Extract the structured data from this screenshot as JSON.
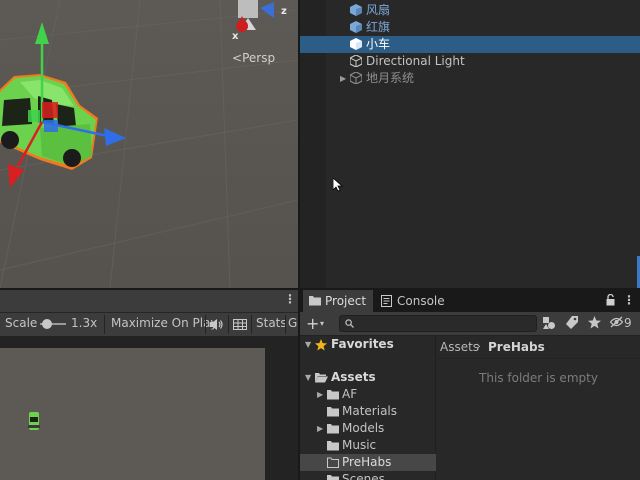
{
  "scene": {
    "persp_label": "Persp",
    "gizmo_axes": {
      "x": "x",
      "z": "z"
    },
    "colors": {
      "car_body": "#6cd24e",
      "car_outline": "#f07a1e",
      "axis_y": "#3fd24a",
      "axis_x": "#d91f1f",
      "axis_z": "#2f6ee6"
    }
  },
  "hierarchy": {
    "items": [
      {
        "label": "风扇",
        "style": "blue",
        "icon": "prefab-cube-icon"
      },
      {
        "label": "红旗",
        "style": "blue",
        "icon": "prefab-cube-icon"
      },
      {
        "label": "小车",
        "style": "selected",
        "icon": "prefab-cube-icon"
      },
      {
        "label": "Directional Light",
        "style": "normal",
        "icon": "gameobject-cube-icon"
      },
      {
        "label": "地月系统",
        "style": "gray",
        "icon": "gameobject-cube-icon",
        "foldout": "▶"
      }
    ],
    "selection_color": "#2c5d87"
  },
  "game": {
    "menu_glyph": "⋮",
    "scale_label": "Scale",
    "scale_value": "1.3x",
    "maximize_label": "Maximize On Play",
    "stats_label": "Stats",
    "gizmos_label": "G"
  },
  "project": {
    "tabs": {
      "project": "Project",
      "console": "Console"
    },
    "menu_glyph": "⋮",
    "add_label": "+",
    "add_caret": "▾",
    "search": {
      "placeholder": ""
    },
    "hidden_count": "9",
    "favorites": {
      "label": "Favorites",
      "fold": "▼"
    },
    "assets": {
      "label": "Assets",
      "fold": "▼",
      "folders": [
        {
          "label": "AF",
          "fold": "▶"
        },
        {
          "label": "Materials",
          "fold": ""
        },
        {
          "label": "Models",
          "fold": "▶"
        },
        {
          "label": "Music",
          "fold": ""
        },
        {
          "label": "PreHabs",
          "fold": "",
          "selected": true
        },
        {
          "label": "Scenes",
          "fold": ""
        }
      ]
    },
    "breadcrumb": {
      "root": "Assets",
      "separator": "›",
      "current": "PreHabs"
    },
    "empty_message": "This folder is empty"
  }
}
